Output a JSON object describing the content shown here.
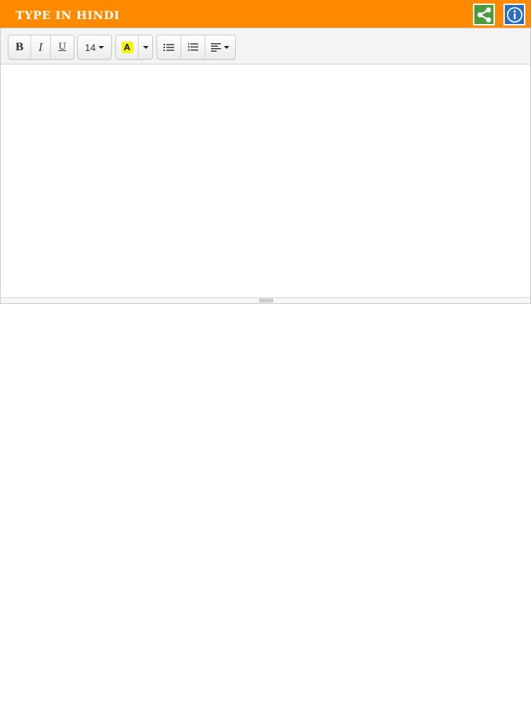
{
  "header": {
    "title": "TYPE IN HINDI",
    "background_color": "#ff8a00",
    "share_icon": "share-icon",
    "info_icon": "info-icon"
  },
  "toolbar": {
    "bold_label": "B",
    "italic_label": "I",
    "underline_label": "U",
    "font_size_value": "14",
    "highlight_label": "A",
    "highlight_color": "#f5f500",
    "unordered_list_icon": "bullet-list-icon",
    "ordered_list_icon": "numbered-list-icon",
    "align_icon": "align-left-icon"
  },
  "editor": {
    "content": ""
  }
}
